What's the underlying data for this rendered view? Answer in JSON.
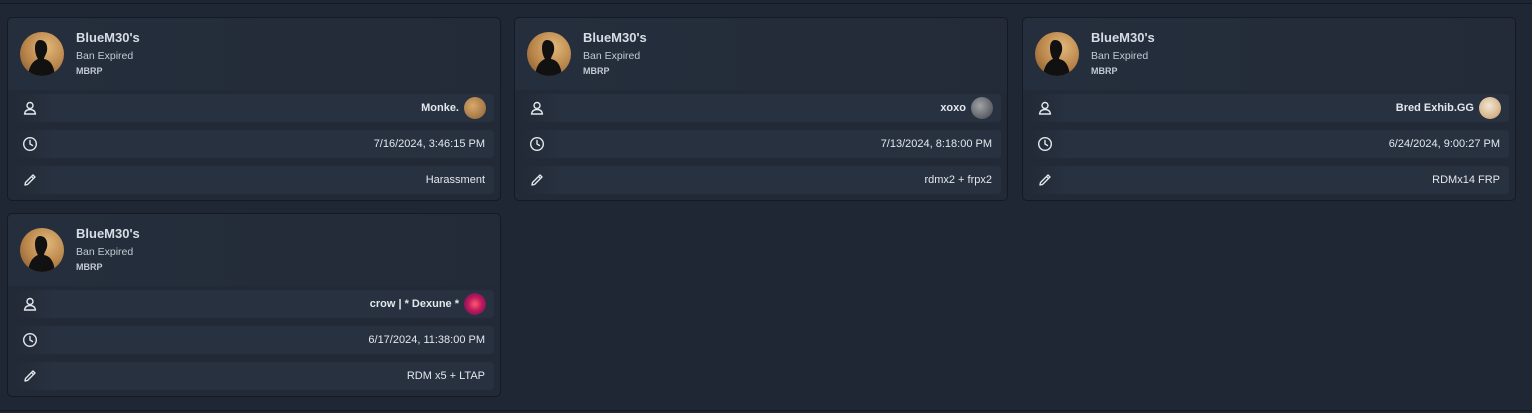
{
  "cards": [
    {
      "title": "BlueM30's",
      "status": "Ban Expired",
      "server": "MBRP",
      "user": "Monke.",
      "date": "7/16/2024, 3:46:15 PM",
      "reason": "Harassment",
      "user_avatar_color": "#b58a5a"
    },
    {
      "title": "BlueM30's",
      "status": "Ban Expired",
      "server": "MBRP",
      "user": "xoxo",
      "date": "7/13/2024, 8:18:00 PM",
      "reason": "rdmx2 + frpx2",
      "user_avatar_color": "#6c6f74"
    },
    {
      "title": "BlueM30's",
      "status": "Ban Expired",
      "server": "MBRP",
      "user": "Bred Exhib.GG",
      "date": "6/24/2024, 9:00:27 PM",
      "reason": "RDMx14 FRP",
      "user_avatar_color": "#e6d7c0"
    },
    {
      "title": "BlueM30's",
      "status": "Ban Expired",
      "server": "MBRP",
      "user": "crow | * Dexune *",
      "date": "6/17/2024, 11:38:00 PM",
      "reason": "RDM x5 + LTAP",
      "user_avatar_color": "#c2185b"
    }
  ],
  "icons": {
    "user": "user-icon",
    "time": "clock-icon",
    "reason": "pencil-icon"
  },
  "colors": {
    "background": "#1f2734",
    "card": "#222a37",
    "row": "#283140",
    "text": "#e3e8ee"
  }
}
